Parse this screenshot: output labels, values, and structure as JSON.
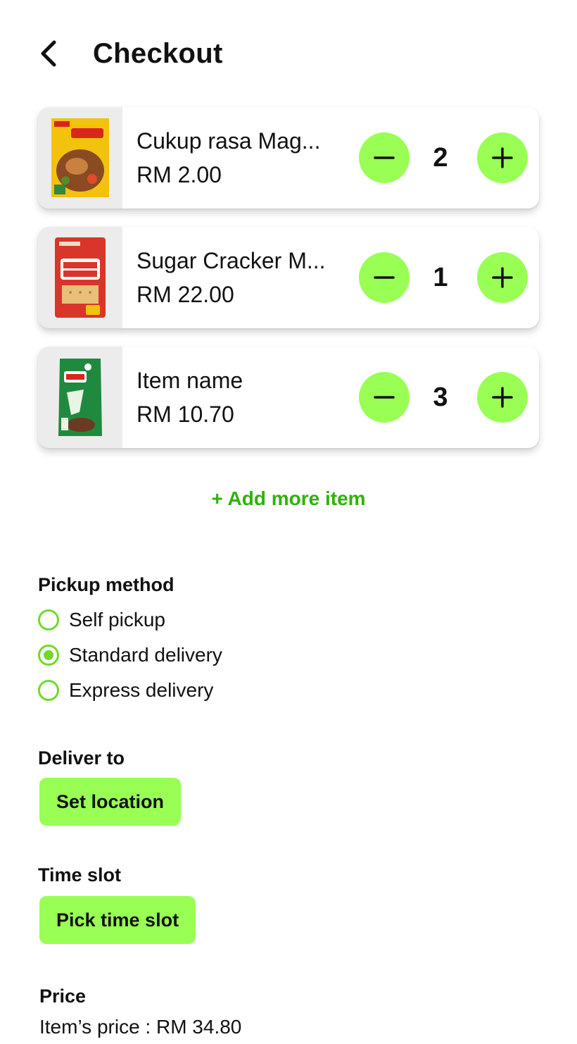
{
  "header": {
    "title": "Checkout"
  },
  "cart": [
    {
      "name": "Cukup rasa Mag...",
      "price": "RM 2.00",
      "quantity": "2",
      "thumb_icon": "seasoning-pack"
    },
    {
      "name": "Sugar Cracker M...",
      "price": "RM 22.00",
      "quantity": "1",
      "thumb_icon": "cracker-pack"
    },
    {
      "name": "Item name",
      "price": "RM 10.70",
      "quantity": "3",
      "thumb_icon": "milo-pack"
    }
  ],
  "add_more_label": "+ Add more item",
  "pickup": {
    "label": "Pickup method",
    "options": [
      {
        "label": "Self pickup",
        "selected": false
      },
      {
        "label": "Standard delivery",
        "selected": true
      },
      {
        "label": "Express delivery",
        "selected": false
      }
    ]
  },
  "deliver": {
    "label": "Deliver to",
    "button": "Set location"
  },
  "timeslot": {
    "label": "Time slot",
    "button": "Pick time slot"
  },
  "price": {
    "label": "Price",
    "items_line": "Item’s price : RM 34.80"
  },
  "colors": {
    "accent": "#99ff55",
    "radio": "#72d92b",
    "link": "#2db307"
  }
}
